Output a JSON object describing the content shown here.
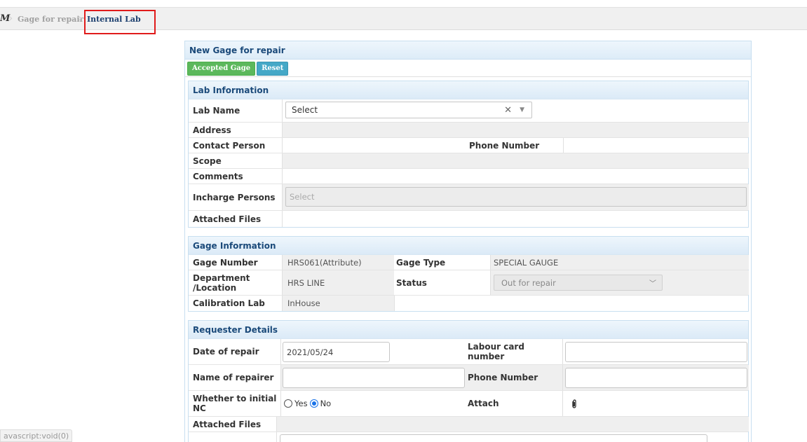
{
  "breadcrumb": {
    "home_glyph": "M",
    "items": [
      "Gage for repair",
      "Internal Lab"
    ]
  },
  "form": {
    "title": "New Gage for repair",
    "buttons": {
      "accept": "Accepted Gage",
      "reset": "Reset"
    }
  },
  "lab_info": {
    "title": "Lab Information",
    "lab_name_label": "Lab Name",
    "lab_name_value": "Select",
    "address_label": "Address",
    "contact_person_label": "Contact Person",
    "phone_number_label": "Phone Number",
    "scope_label": "Scope",
    "comments_label": "Comments",
    "incharge_label": "Incharge Persons",
    "incharge_placeholder": "Select",
    "attached_files_label": "Attached Files"
  },
  "gage_info": {
    "title": "Gage Information",
    "gage_number_label": "Gage Number",
    "gage_number_value": "HRS061(Attribute)",
    "gage_type_label": "Gage Type",
    "gage_type_value": "SPECIAL GAUGE",
    "department_label_1": "Department",
    "department_label_2": "/Location",
    "department_value": "HRS LINE",
    "status_label": "Status",
    "status_value": "Out for repair",
    "calibration_lab_label": "Calibration Lab",
    "calibration_lab_value": "InHouse"
  },
  "requester": {
    "title": "Requester Details",
    "date_label": "Date of repair",
    "date_value": "2021/05/24",
    "labour_card_label": "Labour card number",
    "labour_card_value": "",
    "repairer_label": "Name of repairer",
    "repairer_value": "",
    "phone_label": "Phone Number",
    "phone_value": "",
    "initial_nc_label_1": "Whether to initial",
    "initial_nc_label_2": "NC",
    "yes_label": "Yes",
    "no_label": "No",
    "attach_label": "Attach",
    "attached_files_label": "Attached Files"
  },
  "status_bar": {
    "text": "avascript:void(0)"
  },
  "colors": {
    "accent": "#1b4a7a",
    "highlight": "#e01b1b",
    "green": "#5cb85c",
    "blue": "#45a8c7"
  }
}
